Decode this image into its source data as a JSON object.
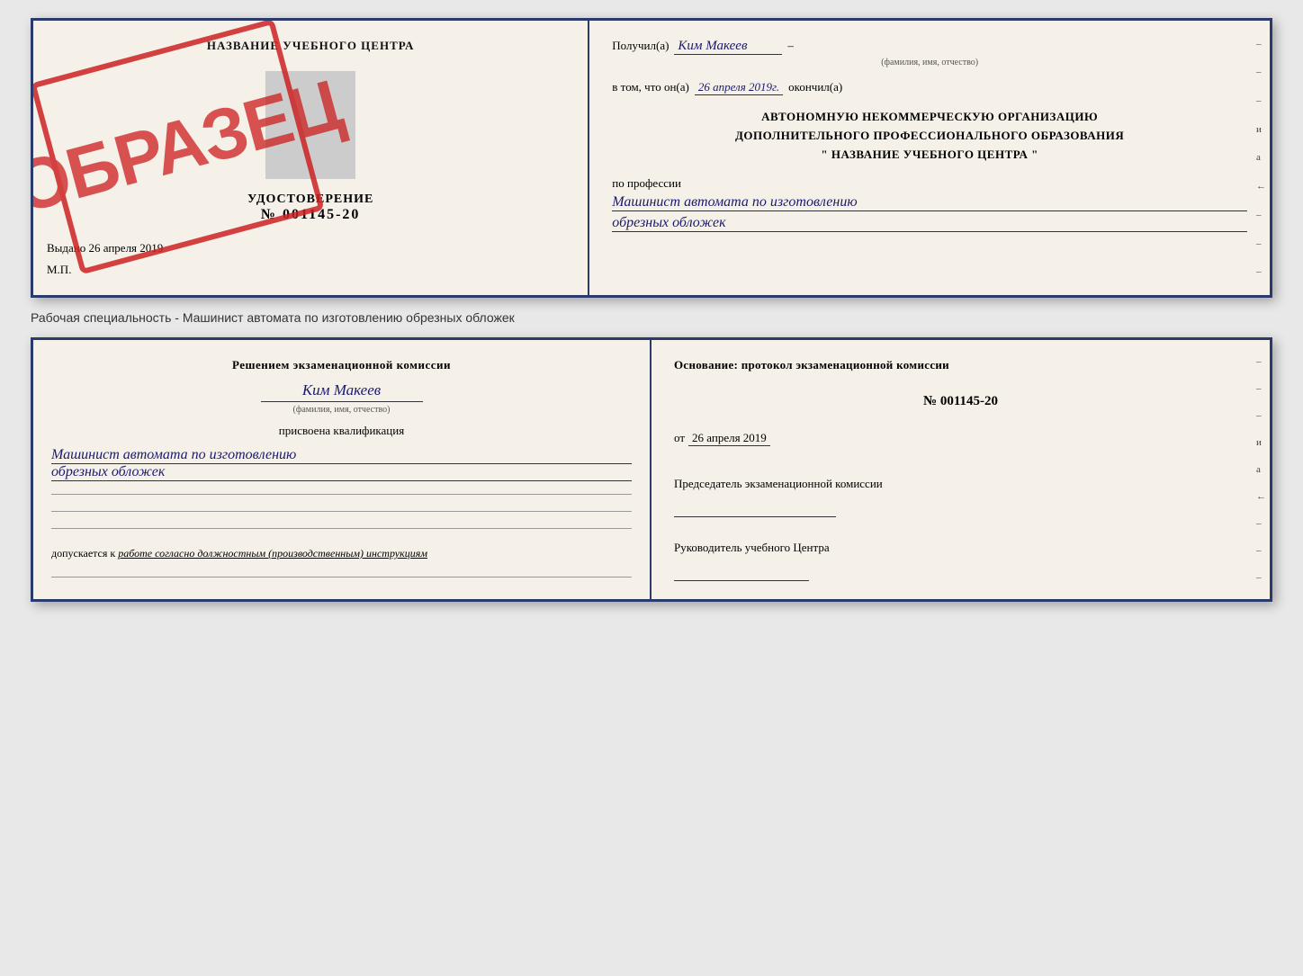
{
  "top_cert": {
    "left": {
      "title": "НАЗВАНИЕ УЧЕБНОГО ЦЕНТРА",
      "stamp_text": "ОБРАЗЕЦ",
      "udostoverenie": {
        "label": "УДОСТОВЕРЕНИЕ",
        "number": "№ 001145-20"
      },
      "vydano": "Выдано 26 апреля 2019",
      "mp": "М.П."
    },
    "right": {
      "poluchil_label": "Получил(а)",
      "fio_value": "Ким Макеев",
      "fio_hint": "(фамилия, имя, отчество)",
      "vtom_label": "в том, что он(а)",
      "date_value": "26 апреля 2019г.",
      "okonchil": "окончил(а)",
      "org_line1": "АВТОНОМНУЮ НЕКОММЕРЧЕСКУЮ ОРГАНИЗАЦИЮ",
      "org_line2": "ДОПОЛНИТЕЛЬНОГО ПРОФЕССИОНАЛЬНОГО ОБРАЗОВАНИЯ",
      "org_name": "\" НАЗВАНИЕ УЧЕБНОГО ЦЕНТРА \"",
      "po_professii": "по профессии",
      "profession_line1": "Машинист автомата по изготовлению",
      "profession_line2": "обрезных обложек",
      "side_marks": [
        "–",
        "–",
        "–",
        "и",
        "а",
        "←",
        "–",
        "–",
        "–"
      ]
    }
  },
  "caption": "Рабочая специальность - Машинист автомата по изготовлению обрезных обложек",
  "bottom_cert": {
    "left": {
      "resheniem": "Решением экзаменационной комиссии",
      "fio_value": "Ким Макеев",
      "fio_hint": "(фамилия, имя, отчество)",
      "prisvoena": "присвоена квалификация",
      "kvalif_line1": "Машинист автомата по изготовлению",
      "kvalif_line2": "обрезных обложек",
      "blank_lines": [
        "",
        "",
        ""
      ],
      "dopuskaetsya": "допускается к",
      "dopusk_value": "работе согласно должностным (производственным) инструкциям",
      "bottom_line": ""
    },
    "right": {
      "osnovaniye_label": "Основание: протокол экзаменационной комиссии",
      "protocol_number": "№ 001145-20",
      "protocol_date_prefix": "от",
      "protocol_date": "26 апреля 2019",
      "predsedatel_label": "Председатель экзаменационной комиссии",
      "rukovoditel_label": "Руководитель учебного Центра",
      "side_marks": [
        "–",
        "–",
        "–",
        "и",
        "а",
        "←",
        "–",
        "–",
        "–"
      ]
    }
  }
}
